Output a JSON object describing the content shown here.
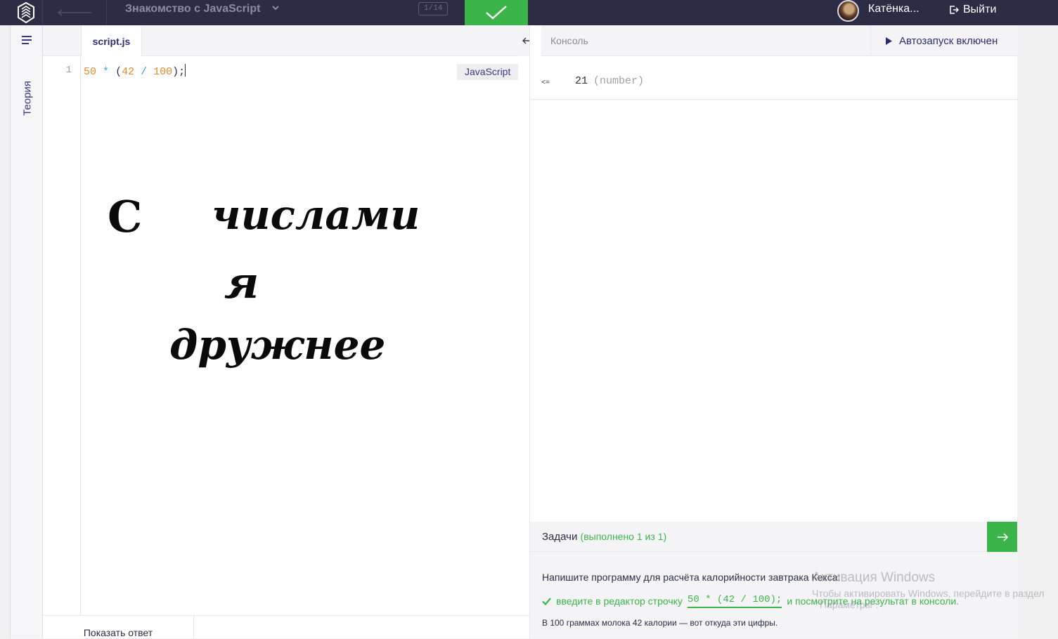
{
  "header": {
    "course_title": "Знакомство с JavaScript",
    "step_counter": "1/14",
    "username": "Катёнка...",
    "logout_label": "Выйти"
  },
  "sidebar": {
    "theory_label": "Теория"
  },
  "editor": {
    "tab_label": "script.js",
    "line_number": "1",
    "code": {
      "num_a": "50",
      "op_mul": "*",
      "paren_open": "(",
      "num_b": "42",
      "op_div": "/",
      "num_c": "100",
      "tail": ");"
    },
    "language_badge": "JavaScript",
    "handwriting": [
      "С",
      "числами",
      "я",
      "дружнее"
    ],
    "show_answer_label": "Показать ответ"
  },
  "console": {
    "title": "Консоль",
    "autorun_label": "Автозапуск включен",
    "arrow": "<=",
    "value": "21",
    "value_type": "(number)"
  },
  "tasks": {
    "title": "Задачи",
    "done_label": "(выполнено 1 из 1)",
    "description": "Напишите программу для расчёта калорийности завтрака Кекса:",
    "item_prefix": "введите в редактор строчку",
    "item_code": "50 * (42 / 100);",
    "item_suffix": "и посмотрите на результат в консоли.",
    "note": "В 100 граммах молока 42 калории — вот откуда эти цифры."
  },
  "watermark": {
    "title": "Активация Windows",
    "line1": "Чтобы активировать Windows, перейдите в раздел",
    "line2": "\"Параметры\"."
  },
  "colors": {
    "topbar": "#2c2c44",
    "accent_green": "#3bb54a",
    "brand_text": "#2c2c72"
  }
}
